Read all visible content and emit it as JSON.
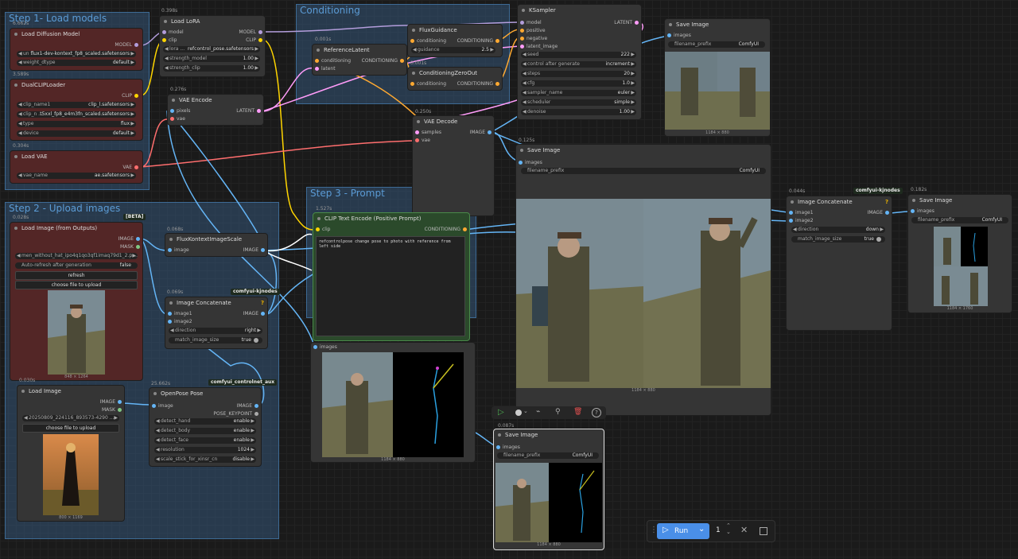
{
  "groups": {
    "step1": "Step 1- Load models",
    "conditioning": "Conditioning",
    "step2": "Step 2 - Upload images",
    "step3": "Step 3 - Prompt"
  },
  "nodes": {
    "load_diffusion": {
      "time": "6.662s",
      "title": "Load Diffusion Model",
      "out_model": "MODEL",
      "unet": "flux1-dev-kontext_fp8_scaled.safetensors",
      "unet_label": "un ...",
      "weight_label": "weight_dtype",
      "weight_value": "default"
    },
    "load_lora": {
      "time": "0.398s",
      "title": "Load LoRA",
      "in_model": "model",
      "in_clip": "clip",
      "out_model": "MODEL",
      "out_clip": "CLIP",
      "lora_label": "lora ...",
      "lora_value": "refcontrol_pose.safetensors",
      "sm_label": "strength_model",
      "sm_value": "1.00",
      "sc_label": "strength_clip",
      "sc_value": "1.00"
    },
    "dual_clip": {
      "time": "3.589s",
      "title": "DualCLIPLoader",
      "out_clip": "CLIP",
      "c1_label": "clip_name1",
      "c1_value": "clip_l.safetensors",
      "c2_label": "clip_n ...",
      "c2_value": "t5xxl_fp8_e4m3fn_scaled.safetensors",
      "type_label": "type",
      "type_value": "flux",
      "device_label": "device",
      "device_value": "default"
    },
    "load_vae": {
      "time": "0.304s",
      "title": "Load VAE",
      "out_vae": "VAE",
      "name_label": "vae_name",
      "name_value": "ae.safetensors"
    },
    "vae_encode": {
      "time": "0.276s",
      "title": "VAE Encode",
      "in_pixels": "pixels",
      "in_vae": "vae",
      "out_latent": "LATENT"
    },
    "reference_latent": {
      "time": "0.001s",
      "title": "ReferenceLatent",
      "in_cond": "conditioning",
      "in_latent": "latent",
      "out_cond": "CONDITIONING"
    },
    "flux_guidance": {
      "title": "FluxGuidance",
      "in_cond": "conditioning",
      "out_cond": "CONDITIONING",
      "g_label": "guidance",
      "g_value": "2.5"
    },
    "cond_zero": {
      "time": "0.001s",
      "title": "ConditioningZeroOut",
      "in_cond": "conditioning",
      "out_cond": "CONDITIONING"
    },
    "ksampler": {
      "title": "KSampler",
      "in_model": "model",
      "in_pos": "positive",
      "in_neg": "negative",
      "in_latent": "latent_image",
      "out_latent": "LATENT",
      "widgets": [
        {
          "label": "seed",
          "value": "222"
        },
        {
          "label": "control after generate",
          "value": "increment"
        },
        {
          "label": "steps",
          "value": "20"
        },
        {
          "label": "cfg",
          "value": "1.0"
        },
        {
          "label": "sampler_name",
          "value": "euler"
        },
        {
          "label": "scheduler",
          "value": "simple"
        },
        {
          "label": "denoise",
          "value": "1.00"
        }
      ]
    },
    "save1": {
      "title": "Save Image",
      "in_images": "images",
      "prefix_label": "filename_prefix",
      "prefix_value": "ComfyUI",
      "caption": "1184 × 880"
    },
    "vae_decode": {
      "time": "0.250s",
      "title": "VAE Decode",
      "in_samples": "samples",
      "in_vae": "vae",
      "out_image": "IMAGE"
    },
    "save2": {
      "time": "0.125s",
      "title": "Save Image",
      "in_images": "images",
      "prefix_label": "filename_prefix",
      "prefix_value": "ComfyUI",
      "caption": "1184 × 880"
    },
    "load_image_outputs": {
      "time": "0.028s",
      "title": "Load Image (from Outputs)",
      "badge": "[BETA]",
      "out_image": "IMAGE",
      "out_mask": "MASK",
      "file": "men_without_hat_ipo4q1qo3qf1imaq79d1_2.p ...",
      "auto_label": "Auto-refresh after generation",
      "auto_value": "false",
      "refresh": "refresh",
      "choose": "choose file to upload",
      "caption": "848 × 1264"
    },
    "flux_scale": {
      "time": "0.068s",
      "title": "FluxKontextImageScale",
      "in_image": "image",
      "out_image": "IMAGE"
    },
    "image_concat1": {
      "time": "0.069s",
      "title": "Image Concatenate",
      "badge": "comfyui-kjnodes",
      "in_image1": "image1",
      "in_image2": "image2",
      "out_image": "IMAGE",
      "dir_label": "direction",
      "dir_value": "right",
      "match_label": "match_image_size",
      "match_value": "true"
    },
    "load_image": {
      "time": "0.030s",
      "title": "Load Image",
      "out_image": "IMAGE",
      "out_mask": "MASK",
      "file": "20250809_224116_893573-4290 ...",
      "choose": "choose file to upload",
      "caption": "800 × 1169"
    },
    "openpose": {
      "time": "25.662s",
      "title": "OpenPose Pose",
      "badge": "comfyui_controlnet_aux",
      "in_image": "image",
      "out_image": "IMAGE",
      "out_kp": "POSE_KEYPOINT",
      "widgets": [
        {
          "label": "detect_hand",
          "value": "enable"
        },
        {
          "label": "detect_body",
          "value": "enable"
        },
        {
          "label": "detect_face",
          "value": "enable"
        },
        {
          "label": "resolution",
          "value": "1024"
        },
        {
          "label": "scale_stick_for_xinsr_cn",
          "value": "disable"
        }
      ]
    },
    "clip_text": {
      "time": "1.527s",
      "title": "CLIP Text Encode (Positive Prompt)",
      "in_clip": "clip",
      "out_cond": "CONDITIONING",
      "prompt": "refcontrolpose change pose to photo with reference from left side"
    },
    "preview": {
      "in_images": "images",
      "caption": "1184 × 880"
    },
    "image_concat2": {
      "time": "0.044s",
      "title": "Image Concatenate",
      "badge": "comfyui-kjnodes",
      "in_image1": "image1",
      "in_image2": "image2",
      "out_image": "IMAGE",
      "dir_label": "direction",
      "dir_value": "down",
      "match_label": "match_image_size",
      "match_value": "true"
    },
    "save3": {
      "time": "0.182s",
      "title": "Save Image",
      "in_images": "images",
      "prefix_label": "filename_prefix",
      "prefix_value": "ComfyUI",
      "caption": "1184 × 1760"
    },
    "save4": {
      "time": "0.087s",
      "title": "Save Image",
      "in_images": "images",
      "prefix_label": "filename_prefix",
      "prefix_value": "ComfyUI",
      "caption": "1184 × 880"
    }
  },
  "runbar": {
    "run_label": "Run",
    "count": "1"
  },
  "colors": {
    "model": "#b39ddb",
    "clip": "#ffd500",
    "vae": "#ff6e6e",
    "latent": "#ff9cf9",
    "image": "#64b5f6",
    "cond": "#ffa931"
  }
}
